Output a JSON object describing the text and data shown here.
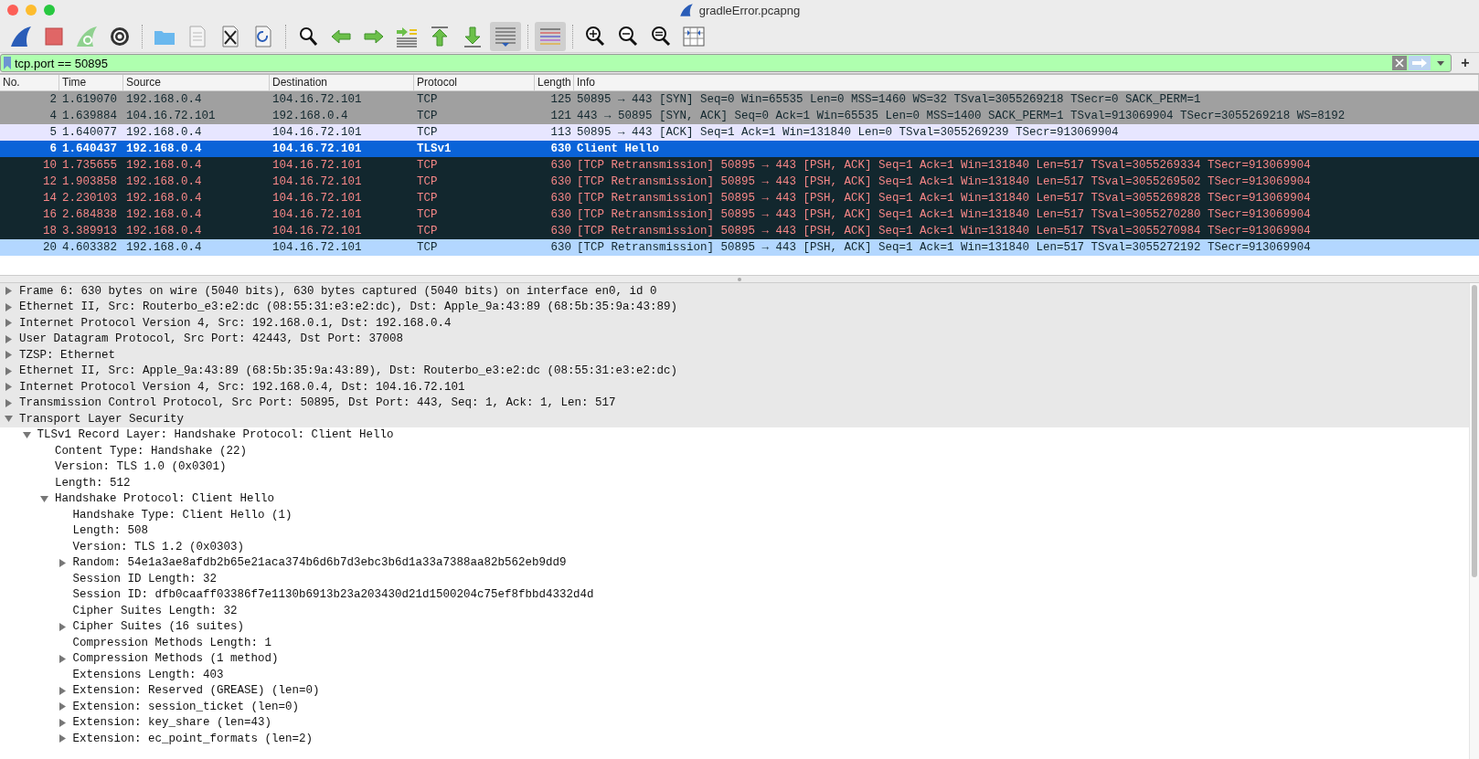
{
  "window": {
    "title": "gradleError.pcapng"
  },
  "toolbar": [
    [
      {
        "kind": "fin",
        "on": false
      },
      {
        "kind": "stop",
        "on": false
      },
      {
        "kind": "restart",
        "on": false
      },
      {
        "kind": "gear",
        "on": false
      }
    ],
    [
      {
        "kind": "folder",
        "on": false
      },
      {
        "kind": "file",
        "on": false
      },
      {
        "kind": "close-file",
        "on": false
      },
      {
        "kind": "reload-file",
        "on": false
      }
    ],
    [
      {
        "kind": "search",
        "on": false
      },
      {
        "kind": "back",
        "on": false
      },
      {
        "kind": "forward",
        "on": false
      },
      {
        "kind": "goto",
        "on": false
      },
      {
        "kind": "first",
        "on": false
      },
      {
        "kind": "last",
        "on": false
      },
      {
        "kind": "autoscroll",
        "on": true
      }
    ],
    [
      {
        "kind": "colorize",
        "on": true
      }
    ],
    [
      {
        "kind": "zoom-in",
        "on": false
      },
      {
        "kind": "zoom-out",
        "on": false
      },
      {
        "kind": "zoom-reset",
        "on": false
      },
      {
        "kind": "resize",
        "on": false
      }
    ]
  ],
  "filter": {
    "value": "tcp.port == 50895",
    "add_button": "+"
  },
  "packet_list": {
    "columns": [
      "No.",
      "Time",
      "Source",
      "Destination",
      "Protocol",
      "Length",
      "Info"
    ],
    "rows": [
      {
        "kind": "handshake",
        "selected": false,
        "cells": [
          "2",
          "1.619070",
          "192.168.0.4",
          "104.16.72.101",
          "TCP",
          "125",
          "50895 → 443 [SYN] Seq=0 Win=65535 Len=0 MSS=1460 WS=32 TSval=3055269218 TSecr=0 SACK_PERM=1"
        ]
      },
      {
        "kind": "handshake",
        "selected": false,
        "cells": [
          "4",
          "1.639884",
          "104.16.72.101",
          "192.168.0.4",
          "TCP",
          "121",
          "443 → 50895 [SYN, ACK] Seq=0 Ack=1 Win=65535 Len=0 MSS=1400 SACK_PERM=1 TSval=913069904 TSecr=3055269218 WS=8192"
        ]
      },
      {
        "kind": "normal",
        "selected": false,
        "cells": [
          "5",
          "1.640077",
          "192.168.0.4",
          "104.16.72.101",
          "TCP",
          "113",
          "50895 → 443 [ACK] Seq=1 Ack=1 Win=131840 Len=0 TSval=3055269239 TSecr=913069904"
        ]
      },
      {
        "kind": "normal",
        "selected": true,
        "cells": [
          "6",
          "1.640437",
          "192.168.0.4",
          "104.16.72.101",
          "TLSv1",
          "630",
          "Client Hello"
        ]
      },
      {
        "kind": "bad",
        "selected": false,
        "cells": [
          "10",
          "1.735655",
          "192.168.0.4",
          "104.16.72.101",
          "TCP",
          "630",
          "[TCP Retransmission] 50895 → 443 [PSH, ACK] Seq=1 Ack=1 Win=131840 Len=517 TSval=3055269334 TSecr=913069904"
        ]
      },
      {
        "kind": "bad",
        "selected": false,
        "cells": [
          "12",
          "1.903858",
          "192.168.0.4",
          "104.16.72.101",
          "TCP",
          "630",
          "[TCP Retransmission] 50895 → 443 [PSH, ACK] Seq=1 Ack=1 Win=131840 Len=517 TSval=3055269502 TSecr=913069904"
        ]
      },
      {
        "kind": "bad",
        "selected": false,
        "cells": [
          "14",
          "2.230103",
          "192.168.0.4",
          "104.16.72.101",
          "TCP",
          "630",
          "[TCP Retransmission] 50895 → 443 [PSH, ACK] Seq=1 Ack=1 Win=131840 Len=517 TSval=3055269828 TSecr=913069904"
        ]
      },
      {
        "kind": "bad",
        "selected": false,
        "cells": [
          "16",
          "2.684838",
          "192.168.0.4",
          "104.16.72.101",
          "TCP",
          "630",
          "[TCP Retransmission] 50895 → 443 [PSH, ACK] Seq=1 Ack=1 Win=131840 Len=517 TSval=3055270280 TSecr=913069904"
        ]
      },
      {
        "kind": "bad",
        "selected": false,
        "cells": [
          "18",
          "3.389913",
          "192.168.0.4",
          "104.16.72.101",
          "TCP",
          "630",
          "[TCP Retransmission] 50895 → 443 [PSH, ACK] Seq=1 Ack=1 Win=131840 Len=517 TSval=3055270984 TSecr=913069904"
        ]
      },
      {
        "kind": "hover",
        "selected": false,
        "cells": [
          "20",
          "4.603382",
          "192.168.0.4",
          "104.16.72.101",
          "TCP",
          "630",
          "[TCP Retransmission] 50895 → 443 [PSH, ACK] Seq=1 Ack=1 Win=131840 Len=517 TSval=3055272192 TSecr=913069904"
        ]
      }
    ]
  },
  "details": [
    {
      "label": "Frame 6: 630 bytes on wire (5040 bits), 630 bytes captured (5040 bits) on interface en0, id 0",
      "expanded": false
    },
    {
      "label": "Ethernet II, Src: Routerbo_e3:e2:dc (08:55:31:e3:e2:dc), Dst: Apple_9a:43:89 (68:5b:35:9a:43:89)",
      "expanded": false
    },
    {
      "label": "Internet Protocol Version 4, Src: 192.168.0.1, Dst: 192.168.0.4",
      "expanded": false
    },
    {
      "label": "User Datagram Protocol, Src Port: 42443, Dst Port: 37008",
      "expanded": false
    },
    {
      "label": "TZSP: Ethernet",
      "expanded": false
    },
    {
      "label": "Ethernet II, Src: Apple_9a:43:89 (68:5b:35:9a:43:89), Dst: Routerbo_e3:e2:dc (08:55:31:e3:e2:dc)",
      "expanded": false
    },
    {
      "label": "Internet Protocol Version 4, Src: 192.168.0.4, Dst: 104.16.72.101",
      "expanded": false
    },
    {
      "label": "Transmission Control Protocol, Src Port: 50895, Dst Port: 443, Seq: 1, Ack: 1, Len: 517",
      "expanded": false
    },
    {
      "label": "Transport Layer Security",
      "expanded": true,
      "children": [
        {
          "label": "TLSv1 Record Layer: Handshake Protocol: Client Hello",
          "expanded": true,
          "children": [
            {
              "label": "Content Type: Handshake (22)"
            },
            {
              "label": "Version: TLS 1.0 (0x0301)"
            },
            {
              "label": "Length: 512"
            },
            {
              "label": "Handshake Protocol: Client Hello",
              "expanded": true,
              "children": [
                {
                  "label": "Handshake Type: Client Hello (1)"
                },
                {
                  "label": "Length: 508"
                },
                {
                  "label": "Version: TLS 1.2 (0x0303)"
                },
                {
                  "label": "Random: 54e1a3ae8afdb2b65e21aca374b6d6b7d3ebc3b6d1a33a7388aa82b562eb9dd9",
                  "expanded": false
                },
                {
                  "label": "Session ID Length: 32"
                },
                {
                  "label": "Session ID: dfb0caaff03386f7e1130b6913b23a203430d21d1500204c75ef8fbbd4332d4d"
                },
                {
                  "label": "Cipher Suites Length: 32"
                },
                {
                  "label": "Cipher Suites (16 suites)",
                  "expanded": false
                },
                {
                  "label": "Compression Methods Length: 1"
                },
                {
                  "label": "Compression Methods (1 method)",
                  "expanded": false
                },
                {
                  "label": "Extensions Length: 403"
                },
                {
                  "label": "Extension: Reserved (GREASE) (len=0)",
                  "expanded": false
                },
                {
                  "label": "Extension: session_ticket (len=0)",
                  "expanded": false
                },
                {
                  "label": "Extension: key_share (len=43)",
                  "expanded": false
                },
                {
                  "label": "Extension: ec_point_formats (len=2)",
                  "expanded": false
                }
              ]
            }
          ]
        }
      ]
    }
  ]
}
